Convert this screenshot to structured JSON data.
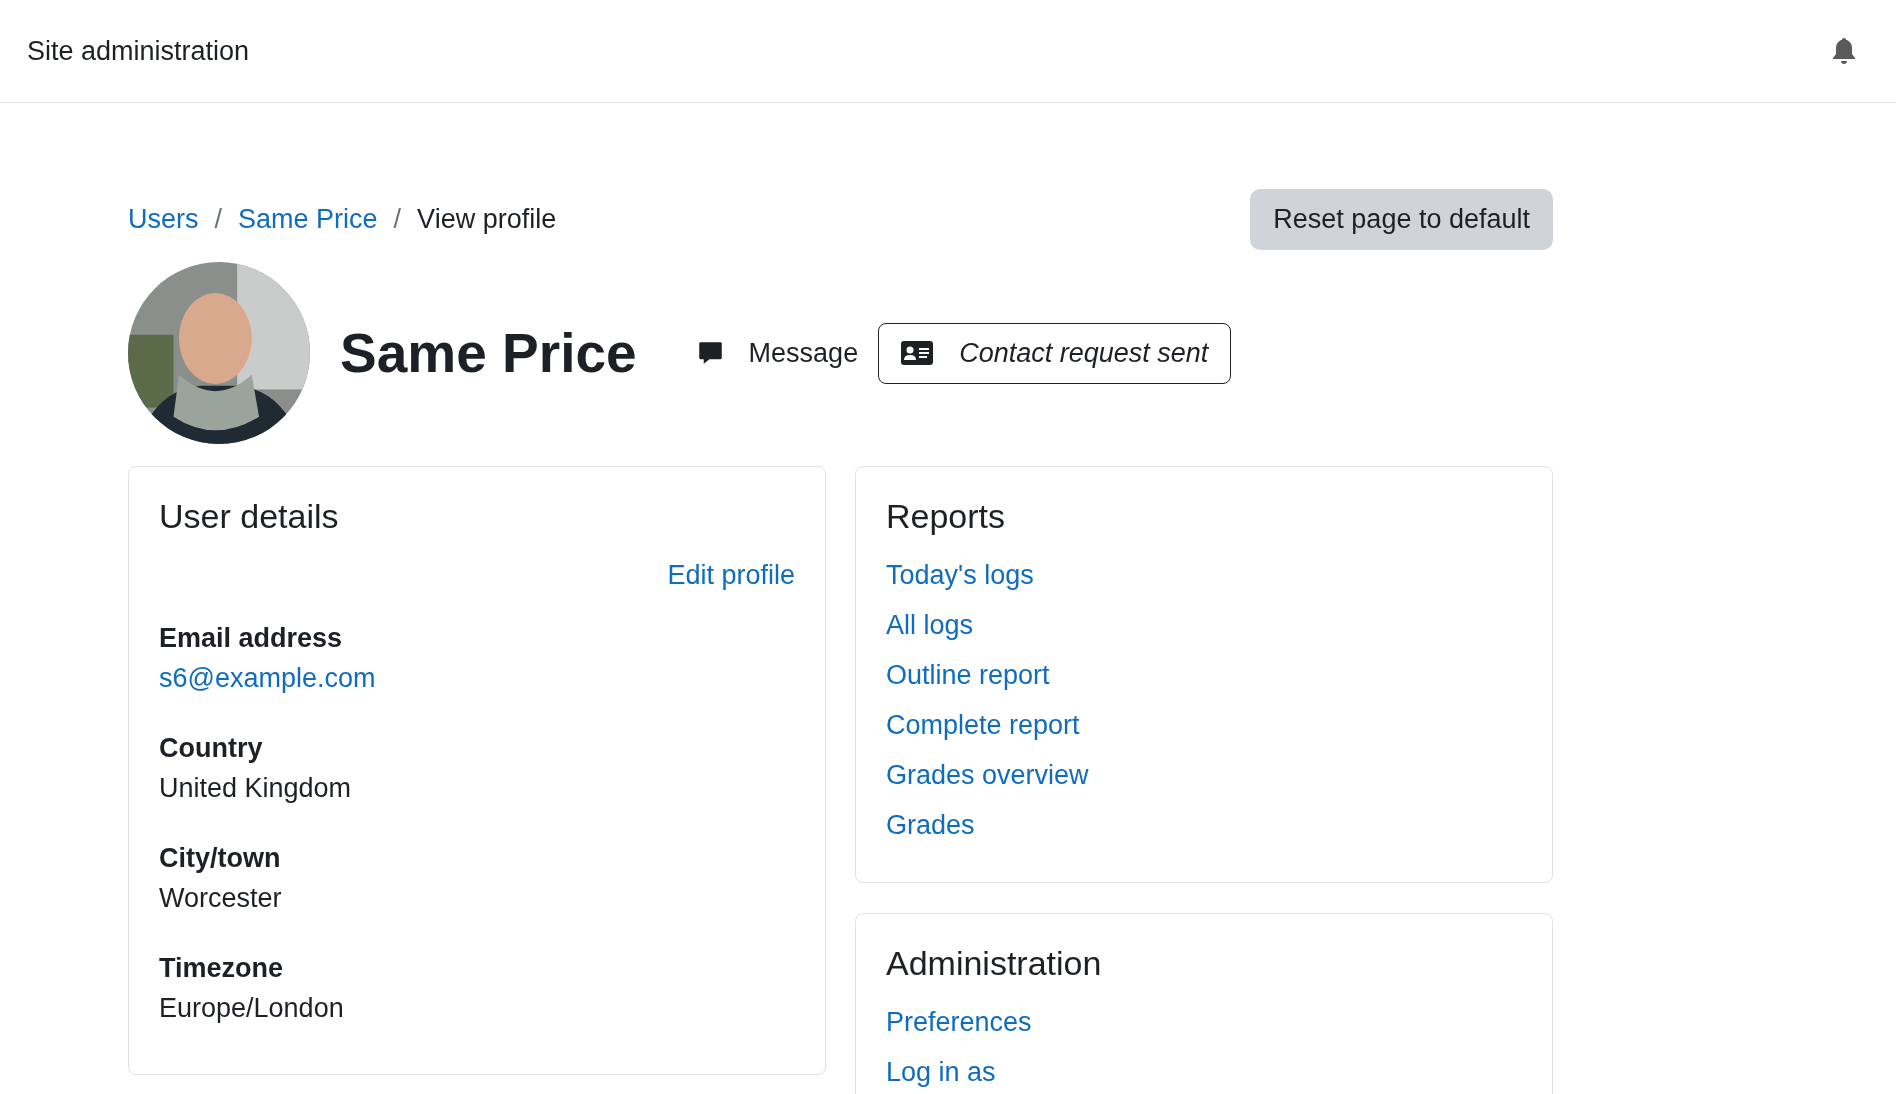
{
  "header": {
    "title": "Site administration"
  },
  "breadcrumb_separator": "/",
  "breadcrumb": [
    {
      "label": "Users",
      "link": true
    },
    {
      "label": "Same Price",
      "link": true
    },
    {
      "label": "View profile",
      "link": false
    }
  ],
  "reset_button": "Reset page to default",
  "profile": {
    "name": "Same Price",
    "message": "Message",
    "contact_button": "Contact request sent"
  },
  "user_details": {
    "title": "User details",
    "edit_link": "Edit profile",
    "fields": [
      {
        "label": "Email address",
        "value": "s6@example.com",
        "link": true
      },
      {
        "label": "Country",
        "value": "United Kingdom",
        "link": false
      },
      {
        "label": "City/town",
        "value": "Worcester",
        "link": false
      },
      {
        "label": "Timezone",
        "value": "Europe/London",
        "link": false
      }
    ]
  },
  "reports": {
    "title": "Reports",
    "links": [
      "Today's logs",
      "All logs",
      "Outline report",
      "Complete report",
      "Grades overview",
      "Grades"
    ]
  },
  "administration": {
    "title": "Administration",
    "links": [
      "Preferences",
      "Log in as"
    ]
  }
}
